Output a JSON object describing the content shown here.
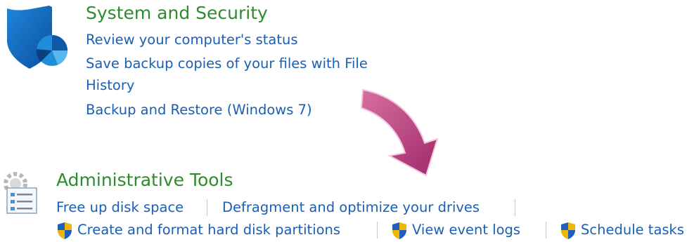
{
  "colors": {
    "heading": "#2e8b2e",
    "link": "#1a5fb4",
    "arrow": "#b03a7a"
  },
  "system_security": {
    "icon": "shield-icon",
    "title": "System and Security",
    "links": [
      "Review your computer's status",
      "Save backup copies of your files with File",
      "History",
      "Backup and Restore (Windows 7)"
    ]
  },
  "admin_tools": {
    "icon": "admin-tools-icon",
    "title": "Administrative Tools",
    "links": [
      "Free up disk space",
      "Defragment and optimize your drives",
      "Create and format hard disk partitions",
      "View event logs",
      "Schedule tasks"
    ],
    "uac_icon": "uac-shield-icon"
  },
  "annotation": {
    "icon": "curved-arrow-icon"
  }
}
